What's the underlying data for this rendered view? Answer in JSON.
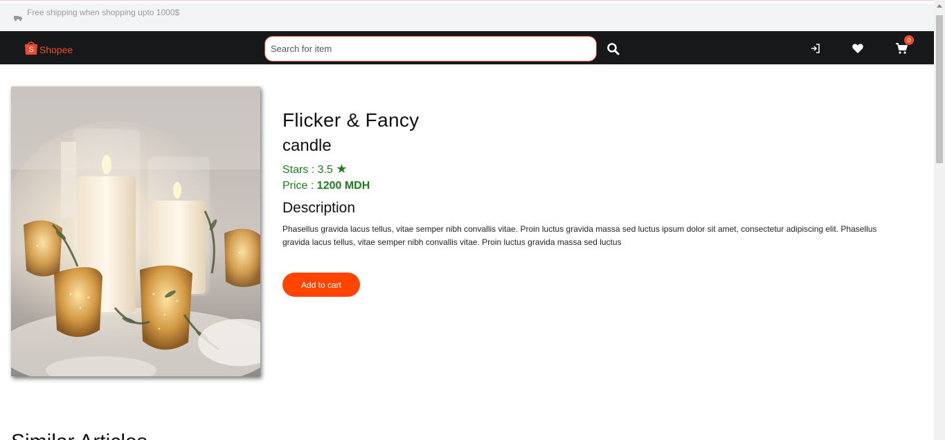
{
  "announcement": {
    "icon": "truck-icon",
    "text": "Free shipping when shopping upto 1000$"
  },
  "navbar": {
    "brand": "Shopee",
    "search_placeholder": "Search for item",
    "cart_count": "0",
    "accent_color": "#ee4d2d"
  },
  "product": {
    "title": "Flicker & Fancy",
    "subtitle": "candle",
    "stars_label": "Stars : 3.5",
    "star_glyph": "★",
    "price_label": "Price : ",
    "price_value": "1200 MDH",
    "description_heading": "Description",
    "description": "Phasellus gravida lacus tellus, vitae semper nibh convallis vitae. Proin luctus gravida massa sed luctus ipsum dolor sit amet, consectetur adipiscing elit. Phasellus gravida lacus tellus, vitae semper nibh convallis vitae. Proin luctus gravida massa sed luctus",
    "add_to_cart_label": "Add to cart",
    "image": "candles-photo"
  },
  "similar_heading": "Similar Articles"
}
